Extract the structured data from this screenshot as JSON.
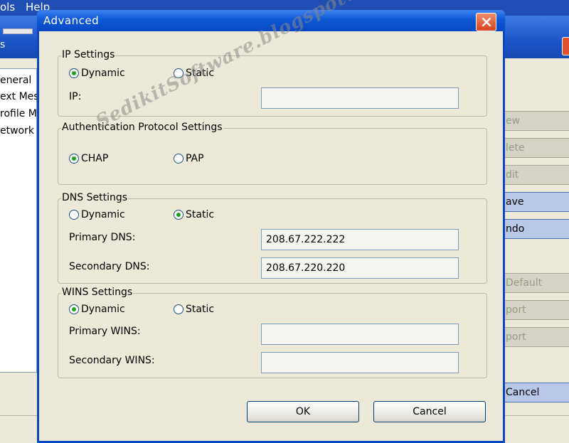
{
  "background_app": {
    "menu": [
      "ols",
      "Help"
    ],
    "title_fragment": "s",
    "list_items": [
      "eneral",
      "ext Mes",
      "rofile M",
      "etwork"
    ],
    "buttons": [
      "ew",
      "lete",
      "dit",
      "ave",
      "ndo",
      "Default",
      "port",
      "port",
      "Cancel"
    ]
  },
  "dialog": {
    "title": "Advanced",
    "ip_settings": {
      "title": "IP Settings",
      "dynamic": "Dynamic",
      "static": "Static",
      "selected": "Dynamic",
      "ip_label": "IP:",
      "ip_value": ""
    },
    "auth_settings": {
      "title": "Authentication Protocol Settings",
      "chap": "CHAP",
      "pap": "PAP",
      "selected": "CHAP"
    },
    "dns_settings": {
      "title": "DNS Settings",
      "dynamic": "Dynamic",
      "static": "Static",
      "selected": "Static",
      "primary_label": "Primary DNS:",
      "primary_value": "208.67.222.222",
      "secondary_label": "Secondary DNS:",
      "secondary_value": "208.67.220.220"
    },
    "wins_settings": {
      "title": "WINS Settings",
      "dynamic": "Dynamic",
      "static": "Static",
      "selected": "Dynamic",
      "primary_label": "Primary WINS:",
      "primary_value": "",
      "secondary_label": "Secondary WINS:",
      "secondary_value": ""
    },
    "ok_label": "OK",
    "cancel_label": "Cancel"
  },
  "watermark": "SedikitSoftware.blogspot.com",
  "colors": {
    "titlebar_blue": "#0a47c4",
    "close_red": "#d9431c",
    "dialog_face": "#ece9d8",
    "radio_checked": "#21a121"
  }
}
